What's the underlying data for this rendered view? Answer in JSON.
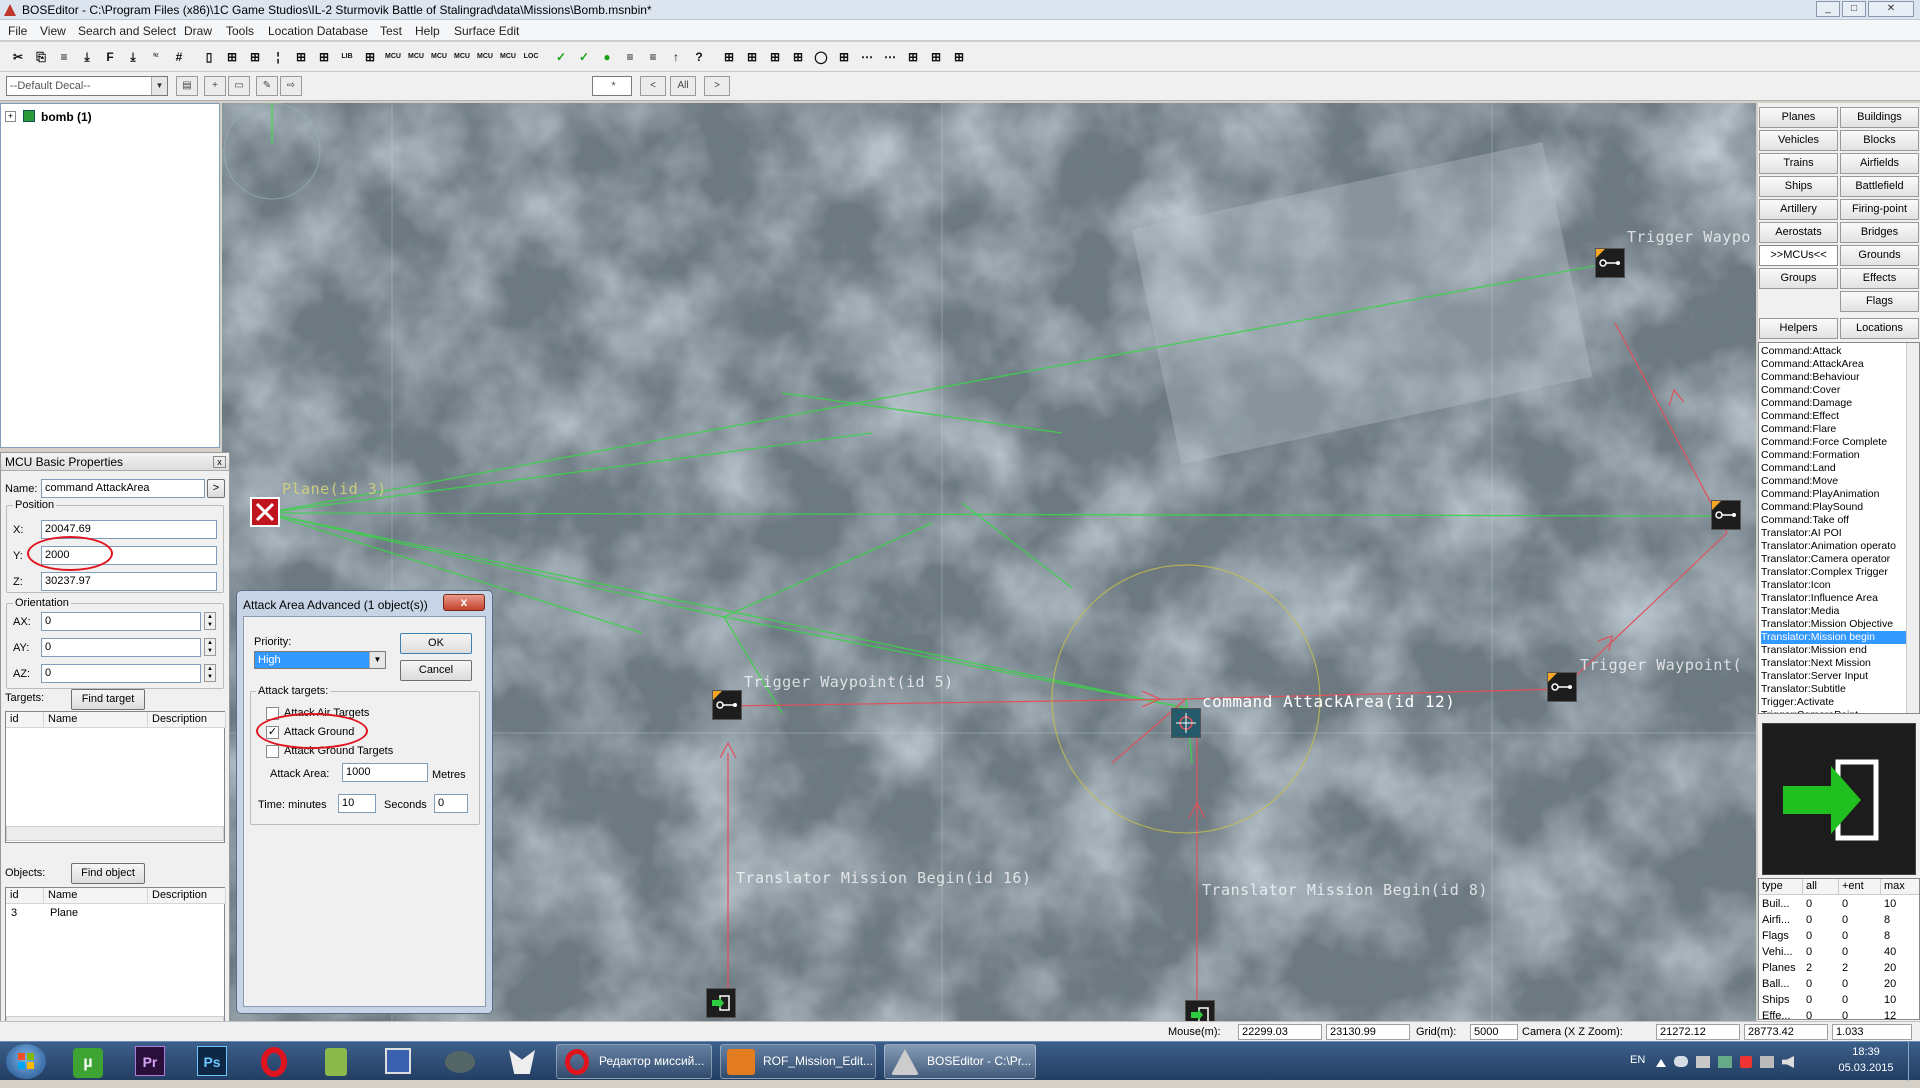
{
  "window": {
    "title": "BOSEditor - C:\\Program Files (x86)\\1C Game Studios\\IL-2 Sturmovik Battle of Stalingrad\\data\\Missions\\Bomb.msnbin*",
    "min": "_",
    "max": "□",
    "close": "✕"
  },
  "menu": [
    "File",
    "View",
    "Search and Select",
    "Draw",
    "Tools",
    "Location Database",
    "Test",
    "Help",
    "Surface Edit"
  ],
  "toolbar2": {
    "decal_combo": "--Default Decal--",
    "filter_value": "*",
    "prev": "<",
    "all": "All",
    "next": ">"
  },
  "tree": {
    "expander": "+",
    "root": "bomb (1)"
  },
  "props": {
    "title": "MCU Basic Properties",
    "close": "x",
    "name_label": "Name:",
    "name_value": "command AttackArea",
    "name_btn": ">",
    "position_label": "Position",
    "x_label": "X:",
    "x_value": "20047.69",
    "y_label": "Y:",
    "y_value": "2000",
    "z_label": "Z:",
    "z_value": "30237.97",
    "orientation_label": "Orientation",
    "ax_label": "AX:",
    "ax_value": "0",
    "ay_label": "AY:",
    "ay_value": "0",
    "az_label": "AZ:",
    "az_value": "0",
    "targets_label": "Targets:",
    "find_target": "Find target",
    "targets_cols": [
      "id",
      "Name",
      "Description"
    ],
    "objects_label": "Objects:",
    "find_object": "Find object",
    "objects_cols": [
      "id",
      "Name",
      "Description"
    ],
    "objects_rows": [
      {
        "id": "3",
        "name": "Plane",
        "desc": ""
      }
    ]
  },
  "map_labels": {
    "plane": "Plane(id 3)",
    "trig_wp_top": "Trigger Waypo",
    "trig_wp_mid": "Trigger Waypoint(",
    "trig_wp5": "Trigger Waypoint(id 5)",
    "attack_area": "command AttackArea(id 12)",
    "tmb16": "Translator Mission Begin(id 16)",
    "tmb8": "Translator Mission Begin(id 8)"
  },
  "dialog": {
    "title": "Attack Area Advanced (1 object(s))",
    "close": "x",
    "priority_label": "Priority:",
    "priority_value": "High",
    "ok": "OK",
    "cancel": "Cancel",
    "attack_targets_label": "Attack targets:",
    "attack_air": "Attack Air Targets",
    "attack_ground": "Attack Ground",
    "attack_ground_targets": "Attack Ground Targets",
    "attack_area_label": "Attack Area:",
    "attack_area_value": "1000",
    "metres": "Metres",
    "time_label": "Time: minutes",
    "minutes_value": "10",
    "seconds_label": "Seconds",
    "seconds_value": "0"
  },
  "categories": [
    [
      "Planes",
      "Buildings"
    ],
    [
      "Vehicles",
      "Blocks"
    ],
    [
      "Trains",
      "Airfields"
    ],
    [
      "Ships",
      "Battlefield"
    ],
    [
      "Artillery",
      "Firing-point"
    ],
    [
      "Aerostats",
      "Bridges"
    ],
    [
      ">>MCUs<<",
      "Grounds"
    ],
    [
      "Groups",
      "Effects"
    ],
    [
      "",
      "Flags"
    ],
    [
      "Helpers",
      "Locations"
    ]
  ],
  "mcu_list": [
    "Command:Attack",
    "Command:AttackArea",
    "Command:Behaviour",
    "Command:Cover",
    "Command:Damage",
    "Command:Effect",
    "Command:Flare",
    "Command:Force Complete",
    "Command:Formation",
    "Command:Land",
    "Command:Move",
    "Command:PlayAnimation",
    "Command:PlaySound",
    "Command:Take off",
    "Translator:AI POI",
    "Translator:Animation operato",
    "Translator:Camera operator",
    "Translator:Complex Trigger",
    "Translator:Icon",
    "Translator:Influence Area",
    "Translator:Media",
    "Translator:Mission Objective",
    "Translator:Mission begin",
    "Translator:Mission end",
    "Translator:Next Mission",
    "Translator:Server Input",
    "Translator:Subtitle",
    "Trigger:Activate",
    "Trigger:CameraPoint"
  ],
  "mcu_selected": "Translator:Mission begin",
  "stats": {
    "cols": [
      "type",
      "all",
      "+ent",
      "max"
    ],
    "rows": [
      [
        "Buil...",
        "0",
        "0",
        "10"
      ],
      [
        "Airfi...",
        "0",
        "0",
        "8"
      ],
      [
        "Flags",
        "0",
        "0",
        "8"
      ],
      [
        "Vehi...",
        "0",
        "0",
        "40"
      ],
      [
        "Planes",
        "2",
        "2",
        "20"
      ],
      [
        "Ball...",
        "0",
        "0",
        "20"
      ],
      [
        "Ships",
        "0",
        "0",
        "10"
      ],
      [
        "Effe...",
        "0",
        "0",
        "12"
      ]
    ]
  },
  "status": {
    "mouse_label": "Mouse(m):",
    "mouse_x": "22299.03",
    "mouse_z": "23130.99",
    "grid_label": "Grid(m):",
    "grid_value": "5000",
    "camera_label": "Camera (X Z Zoom):",
    "cam_x": "21272.12",
    "cam_z": "28773.42",
    "zoom": "1.033"
  },
  "taskbar": {
    "pins": [
      "µ",
      "Pr",
      "Ps"
    ],
    "tasks": [
      "Редактор миссий...",
      "ROF_Mission_Edit...",
      "BOSEditor - C:\\Pr..."
    ],
    "lang": "EN",
    "time": "18:39",
    "date": "05.03.2015"
  },
  "colors": {
    "link_green": "#3cd24a",
    "link_red": "#e0505a",
    "ring_red": "#e0141e",
    "node_bg": "#1d1d1d",
    "accent_orange": "#f5a623",
    "selection": "#3399ff"
  }
}
